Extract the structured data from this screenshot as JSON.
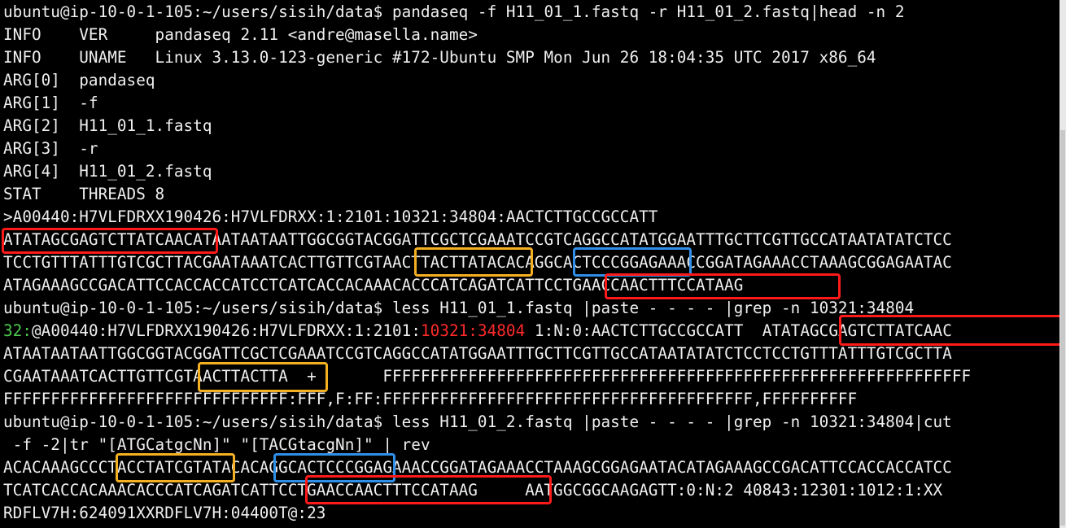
{
  "terminal": {
    "lines": [
      "ubuntu@ip-10-0-1-105:~/users/sisih/data$ pandaseq -f H11_01_1.fastq -r H11_01_2.fastq|head -n 2",
      "INFO    VER     pandaseq 2.11 <andre@masella.name>",
      "INFO    UNAME   Linux 3.13.0-123-generic #172-Ubuntu SMP Mon Jun 26 18:04:35 UTC 2017 x86_64",
      "ARG[0]  pandaseq",
      "ARG[1]  -f",
      "ARG[2]  H11_01_1.fastq",
      "ARG[3]  -r",
      "ARG[4]  H11_01_2.fastq",
      "STAT    THREADS 8",
      ">A00440:H7VLFDRXX190426:H7VLFDRXX:1:2101:10321:34804:AACTCTTGCCGCCATT",
      "ATATAGCGAGTCTTATCAACATAATAATAATTGGCGGTACGGATTCGCTCGAAATCCGTCAGGCCATATGGAATTTGCTTCGTTGCCATAATATATCTCC",
      "TCCTGTTTATTTGTCGCTTACGAATAAATCACTTGTTCGTAACTTACTTATACACAGGCACTCCCGGAGAAACCGGATAGAAACCTAAAGCGGAGAATAC",
      "ATAGAAAGCCGACATTCCACCACCATCCTCATCACCACAAACACCCATCAGATCATTCCTGAACCAACTTTCCATAAG",
      "ubuntu@ip-10-0-1-105:~/users/sisih/data$ less H11_01_1.fastq |paste - - - - |grep -n 10321:34804"
    ],
    "grep_line": {
      "line_number": "32",
      "separator": ":",
      "read_id_prefix": "@A00440:H7VLFDRXX190426:H7VLFDRXX:1:2101:",
      "match": "10321:34804",
      "rest": " 1:N:0:AACTCTTGCCGCCATT  ATATAGCGAGTCTTATCAAC"
    },
    "lines_after": [
      "ATAATAATAATTGGCGGTACGGATTCGCTCGAAATCCGTCAGGCCATATGGAATTTGCTTCGTTGCCATAATATATCTCCTCCTGTTTATTTGTCGCTTA",
      "CGAATAAATCACTTGTTCGTAACTTACTTA  +       FFFFFFFFFFFFFFFFFFFFFFFFFFFFFFFFFFFFFFFFFFFFFFFFFFFFFFFFFFFFFF",
      "FFFFFFFFFFFFFFFFFFFFFFFFFFFFFF:FFF,F:FF:FFFFFFFFFFFFFFFFFFFFFFFFFFFFFFFFFFFFFFF,FFFFFFFFFF",
      "ubuntu@ip-10-0-1-105:~/users/sisih/data$ less H11_01_2.fastq |paste - - - - |grep -n 10321:34804|cut",
      " -f -2|tr \"[ATGCatgcNn]\" \"[TACGtacgNn]\" | rev",
      "ACACAAAGCCCTACCTATCGTATACACAGGCACTCCCGGAGAAACCGGATAGAAACCTAAAGCGGAGAATACATAGAAAGCCGACATTCCACCACCATCC",
      "TCATCACCACAAACACCCATCAGATCATTCCTGAACCAACTTTCCATAAG     AATGGCGGCAAGAGTT:0:N:2 40843:12301:1012:1:XX",
      "RDFLV7H:624091XXRDFLV7H:04400T@:23"
    ]
  },
  "annotation_colors": {
    "red": "#ff1a1a",
    "orange": "#f5b021",
    "blue": "#2f8fe8"
  }
}
